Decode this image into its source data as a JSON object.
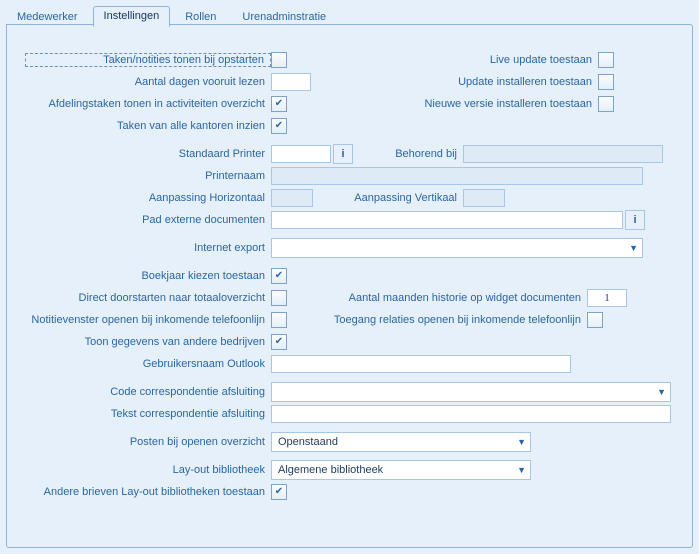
{
  "tabs": {
    "medewerker": "Medewerker",
    "instellingen": "Instellingen",
    "rollen": "Rollen",
    "urenadministratie": "Urenadminstratie"
  },
  "s1": {
    "taken_notities": {
      "label": "Taken/notities tonen bij opstarten",
      "checked": false
    },
    "aantal_dagen": {
      "label": "Aantal dagen vooruit lezen",
      "value": ""
    },
    "afdelingstaken": {
      "label": "Afdelingstaken tonen in activiteiten overzicht",
      "checked": true
    },
    "alle_kantoren": {
      "label": "Taken van alle kantoren inzien",
      "checked": true
    },
    "live_update": {
      "label": "Live update toestaan",
      "checked": false
    },
    "update_install": {
      "label": "Update  installeren toestaan",
      "checked": false
    },
    "nieuwe_versie": {
      "label": "Nieuwe versie installeren toestaan",
      "checked": false
    }
  },
  "s2": {
    "standaard_printer": {
      "label": "Standaard Printer",
      "value": ""
    },
    "behorend_bij": {
      "label": "Behorend bij",
      "value": ""
    },
    "printernaam": {
      "label": "Printernaam",
      "value": ""
    },
    "aan_hor": {
      "label": "Aanpassing Horizontaal",
      "value": ""
    },
    "aan_ver": {
      "label": "Aanpassing Vertikaal",
      "value": ""
    },
    "pad_ext": {
      "label": "Pad externe documenten",
      "value": ""
    }
  },
  "s3": {
    "internet_export": {
      "label": "Internet export",
      "value": ""
    }
  },
  "s4": {
    "boekjaar": {
      "label": "Boekjaar kiezen toestaan",
      "checked": true
    },
    "doorstart": {
      "label": "Direct doorstarten naar totaaloverzicht",
      "checked": false
    },
    "maanden": {
      "label": "Aantal maanden historie op widget documenten",
      "value": "1"
    },
    "notitiev": {
      "label": "Notitievenster openen bij inkomende telefoonlijn",
      "checked": false
    },
    "toegang": {
      "label": "Toegang relaties openen bij inkomende telefoonlijn",
      "checked": false
    },
    "andere_bed": {
      "label": "Toon gegevens van andere bedrijven",
      "checked": true
    },
    "outlook": {
      "label": "Gebruikersnaam Outlook",
      "value": ""
    }
  },
  "s5": {
    "code": {
      "label": "Code correspondentie afsluiting",
      "value": ""
    },
    "tekst": {
      "label": "Tekst correspondentie afsluiting",
      "value": ""
    }
  },
  "s6": {
    "posten": {
      "label": "Posten bij openen overzicht",
      "value": "Openstaand"
    }
  },
  "s7": {
    "layout": {
      "label": "Lay-out bibliotheek",
      "value": "Algemene bibliotheek"
    },
    "andere_lo": {
      "label": "Andere brieven Lay-out bibliotheken toestaan",
      "checked": true
    }
  },
  "icons": {
    "info": "i",
    "drop": "▼"
  }
}
